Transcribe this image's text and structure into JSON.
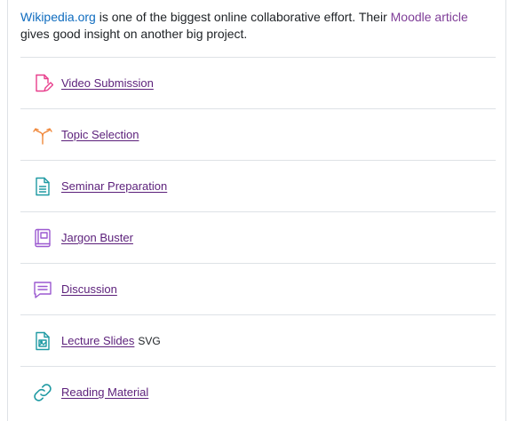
{
  "intro": {
    "link1": "Wikipedia.org",
    "text1": " is one of the biggest online collaborative effort. Their ",
    "link2": "Moodle article",
    "text2": " gives good insight on another big project."
  },
  "activities": [
    {
      "label": "Video Submission",
      "icon": "assignment-icon",
      "color": "#e83e8c"
    },
    {
      "label": "Topic Selection",
      "icon": "choice-icon",
      "color": "#f0883b"
    },
    {
      "label": "Seminar Preparation",
      "icon": "page-icon",
      "color": "#1f9aa3"
    },
    {
      "label": "Jargon Buster",
      "icon": "glossary-icon",
      "color": "#9b59d0"
    },
    {
      "label": "Discussion ",
      "icon": "forum-icon",
      "color": "#9b59d0"
    },
    {
      "label": "Lecture Slides ",
      "extra": "SVG",
      "icon": "image-file-icon",
      "color": "#1f9aa3"
    },
    {
      "label": "Reading Material",
      "icon": "url-link-icon",
      "color": "#1f9aa3"
    }
  ]
}
